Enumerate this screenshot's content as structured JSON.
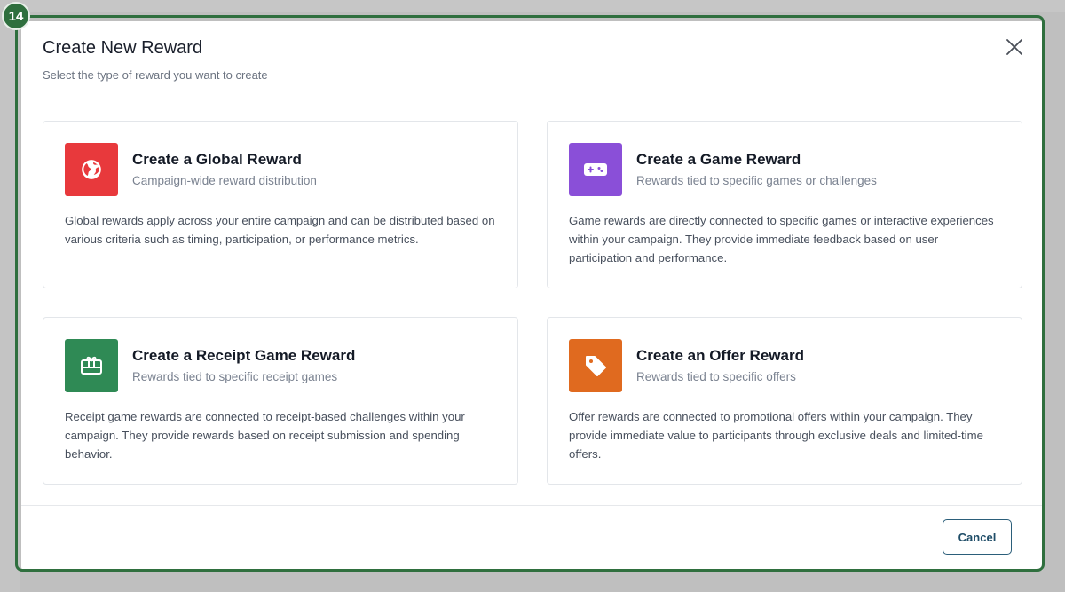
{
  "step_badge": "14",
  "modal": {
    "title": "Create New Reward",
    "subtitle": "Select the type of reward you want to create",
    "close_icon": "close-icon"
  },
  "cards": [
    {
      "title": "Create a Global Reward",
      "subtitle": "Campaign-wide reward distribution",
      "description": "Global rewards apply across your entire campaign and can be distributed based on various criteria such as timing, participation, or performance metrics.",
      "icon": "globe-icon",
      "color": "#e8393c"
    },
    {
      "title": "Create a Game Reward",
      "subtitle": "Rewards tied to specific games or challenges",
      "description": "Game rewards are directly connected to specific games or interactive experiences within your campaign. They provide immediate feedback based on user participation and performance.",
      "icon": "gamepad-icon",
      "color": "#8a4fd8"
    },
    {
      "title": "Create a Receipt Game Reward",
      "subtitle": "Rewards tied to specific receipt games",
      "description": "Receipt game rewards are connected to receipt-based challenges within your campaign. They provide rewards based on receipt submission and spending behavior.",
      "icon": "gift-card-icon",
      "color": "#2f8a55"
    },
    {
      "title": "Create an Offer Reward",
      "subtitle": "Rewards tied to specific offers",
      "description": "Offer rewards are connected to promotional offers within your campaign. They provide immediate value to participants through exclusive deals and limited-time offers.",
      "icon": "tag-icon",
      "color": "#e06a1f"
    }
  ],
  "footer": {
    "cancel_label": "Cancel"
  }
}
